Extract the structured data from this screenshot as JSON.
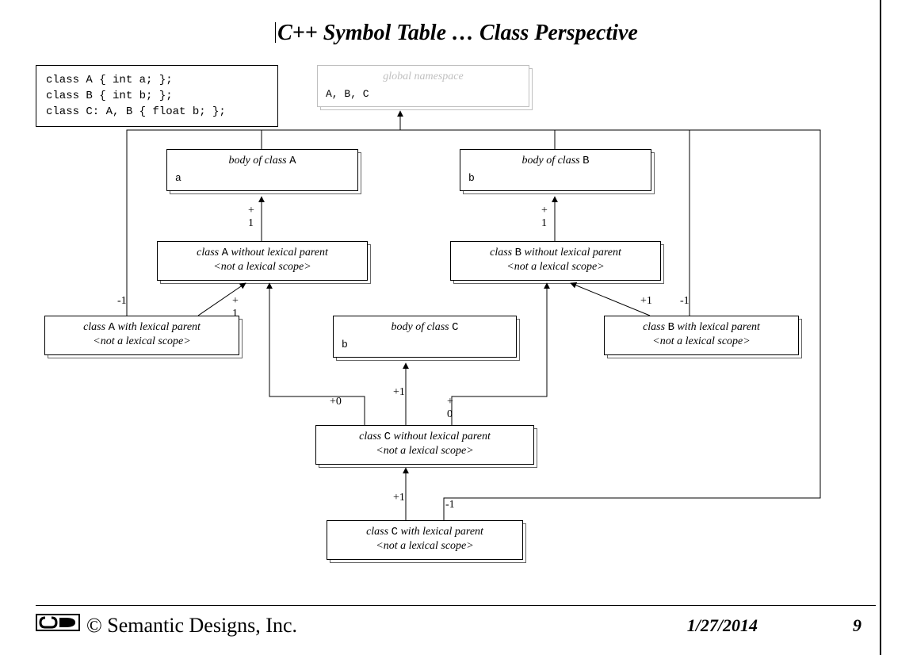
{
  "title": "C++ Symbol Table … Class Perspective",
  "code": "class A { int a; };\nclass B { int b; };\nclass C: A, B { float b; };",
  "nodes": {
    "global": {
      "caption": "global namespace",
      "payload": "A, B, C"
    },
    "bodyA": {
      "caption_pre": "body of class ",
      "caption_mono": "A",
      "payload": "a"
    },
    "bodyB": {
      "caption_pre": "body of class ",
      "caption_mono": "B",
      "payload": "b"
    },
    "bodyC": {
      "caption_pre": "body of class ",
      "caption_mono": "C",
      "payload": "b"
    },
    "noLexA": {
      "line1_pre": "class ",
      "line1_mono": "A",
      "line1_post": " without lexical parent",
      "note": "<not a lexical scope>"
    },
    "noLexB": {
      "line1_pre": "class ",
      "line1_mono": "B",
      "line1_post": " without lexical parent",
      "note": "<not a lexical scope>"
    },
    "noLexC": {
      "line1_pre": "class ",
      "line1_mono": "C",
      "line1_post": " without lexical parent",
      "note": "<not a lexical scope>"
    },
    "lexA": {
      "line1_pre": "class ",
      "line1_mono": "A",
      "line1_post": " with lexical parent",
      "note": "<not a lexical scope>"
    },
    "lexB": {
      "line1_pre": "class ",
      "line1_mono": "B",
      "line1_post": " with lexical parent",
      "note": "<not a lexical scope>"
    },
    "lexC": {
      "line1_pre": "class ",
      "line1_mono": "C",
      "line1_post": " with lexical parent",
      "note": "<not a lexical scope>"
    }
  },
  "edge_labels": {
    "bodyA_plus": "+",
    "bodyA_one": "1",
    "bodyB_plus": "+",
    "bodyB_one": "1",
    "lexA_minus1": "-1",
    "lexA_plus": "+",
    "lexA_one": "1",
    "lexB_minus1": "-1",
    "lexB_plus1": "+1",
    "bodyC_plus0": "+0",
    "bodyC_plus1": "+1",
    "bodyC_plus": "+",
    "bodyC_zero": "0",
    "noLexC_plus1": "+1",
    "noLexC_minus1": "-1"
  },
  "footer": {
    "copyright": "© Semantic Designs, Inc.",
    "date": "1/27/2014",
    "page": "9"
  }
}
